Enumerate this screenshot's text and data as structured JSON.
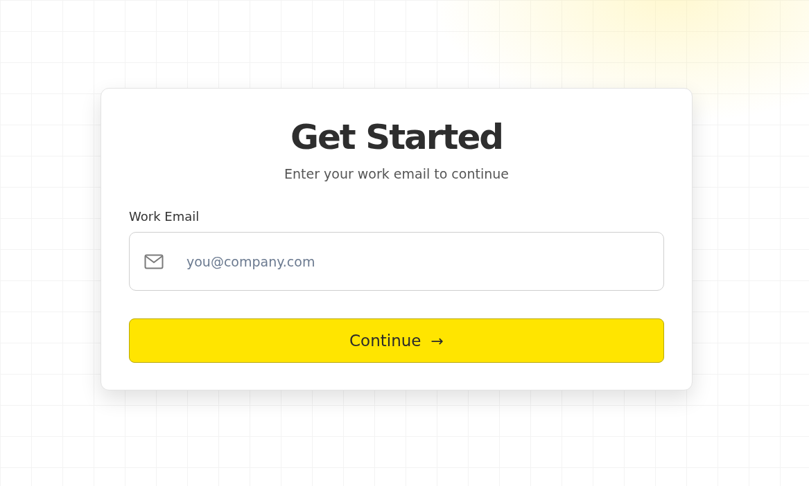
{
  "title": "Get Started",
  "subtitle": "Enter your work email to continue",
  "email_field": {
    "label": "Work Email",
    "placeholder": "you@company.com"
  },
  "continue_button": {
    "label": "Continue",
    "arrow": "→"
  }
}
